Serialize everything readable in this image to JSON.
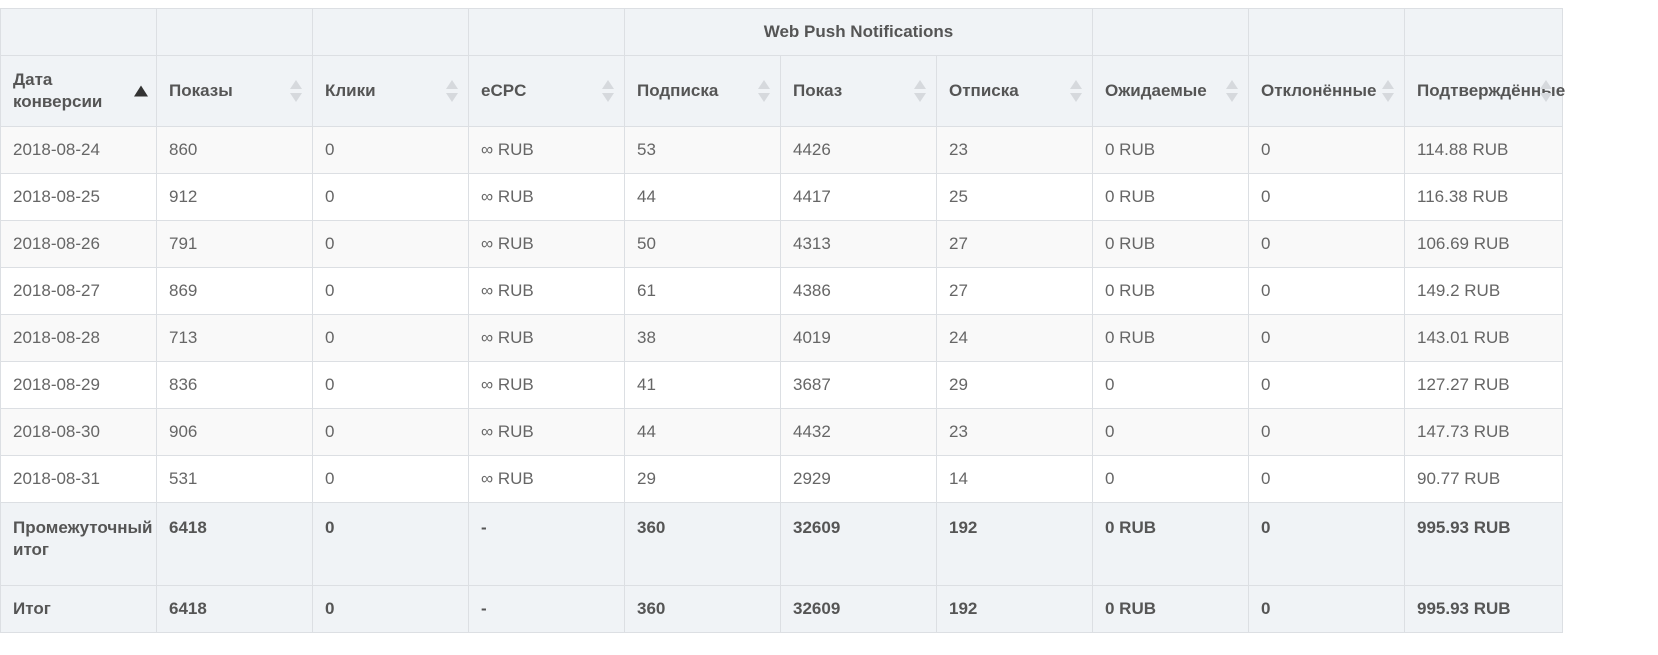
{
  "group_header": {
    "label": "Web Push Notifications"
  },
  "columns": [
    {
      "label": "Дата конверсии",
      "sort": "asc"
    },
    {
      "label": "Показы",
      "sort": "none"
    },
    {
      "label": "Клики",
      "sort": "none"
    },
    {
      "label": "eCPC",
      "sort": "none"
    },
    {
      "label": "Подписка",
      "sort": "none"
    },
    {
      "label": "Показ",
      "sort": "none"
    },
    {
      "label": "Отписка",
      "sort": "none"
    },
    {
      "label": "Ожидаемые",
      "sort": "none"
    },
    {
      "label": "Отклонённые",
      "sort": "none"
    },
    {
      "label": "Подтверждённые",
      "sort": "none"
    }
  ],
  "rows": [
    [
      "2018-08-24",
      "860",
      "0",
      "∞ RUB",
      "53",
      "4426",
      "23",
      "0 RUB",
      "0",
      "114.88 RUB"
    ],
    [
      "2018-08-25",
      "912",
      "0",
      "∞ RUB",
      "44",
      "4417",
      "25",
      "0 RUB",
      "0",
      "116.38 RUB"
    ],
    [
      "2018-08-26",
      "791",
      "0",
      "∞ RUB",
      "50",
      "4313",
      "27",
      "0 RUB",
      "0",
      "106.69 RUB"
    ],
    [
      "2018-08-27",
      "869",
      "0",
      "∞ RUB",
      "61",
      "4386",
      "27",
      "0 RUB",
      "0",
      "149.2 RUB"
    ],
    [
      "2018-08-28",
      "713",
      "0",
      "∞ RUB",
      "38",
      "4019",
      "24",
      "0 RUB",
      "0",
      "143.01 RUB"
    ],
    [
      "2018-08-29",
      "836",
      "0",
      "∞ RUB",
      "41",
      "3687",
      "29",
      "0",
      "0",
      "127.27 RUB"
    ],
    [
      "2018-08-30",
      "906",
      "0",
      "∞ RUB",
      "44",
      "4432",
      "23",
      "0",
      "0",
      "147.73 RUB"
    ],
    [
      "2018-08-31",
      "531",
      "0",
      "∞ RUB",
      "29",
      "2929",
      "14",
      "0",
      "0",
      "90.77 RUB"
    ]
  ],
  "subtotal": [
    "Промежуточный итог",
    "6418",
    "0",
    "-",
    "360",
    "32609",
    "192",
    "0 RUB",
    "0",
    "995.93 RUB"
  ],
  "total": [
    "Итог",
    "6418",
    "0",
    "-",
    "360",
    "32609",
    "192",
    "0 RUB",
    "0",
    "995.93 RUB"
  ]
}
